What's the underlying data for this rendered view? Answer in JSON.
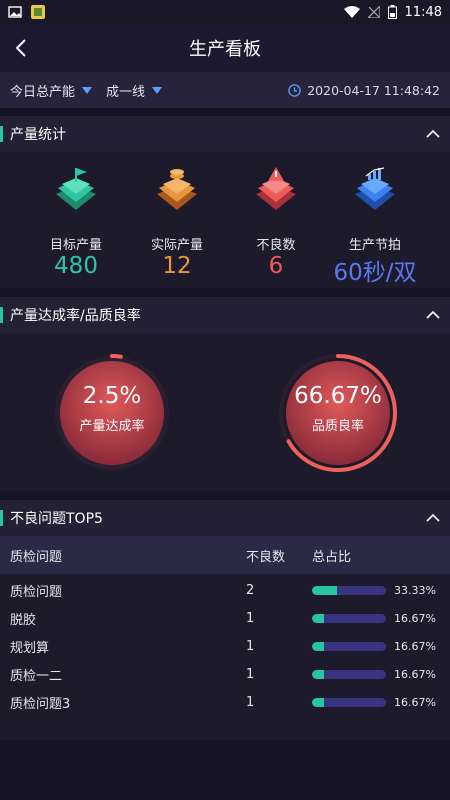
{
  "status": {
    "time": "11:48"
  },
  "nav": {
    "title": "生产看板"
  },
  "filters": {
    "capacity_label": "今日总产能",
    "line_label": "成一线",
    "datetime": "2020-04-17  11:48:42"
  },
  "production": {
    "title": "产量统计",
    "stats": [
      {
        "label": "目标产量",
        "value": "480",
        "color": "#2ec6a2",
        "icon": "flag-pyramid-icon"
      },
      {
        "label": "实际产量",
        "value": "12",
        "color": "#e8973b",
        "icon": "coins-pyramid-icon"
      },
      {
        "label": "不良数",
        "value": "6",
        "color": "#f05a5a",
        "icon": "warning-pyramid-icon"
      },
      {
        "label": "生产节拍",
        "value": "60秒/双",
        "color": "#5b78f0",
        "icon": "trend-pyramid-icon"
      }
    ]
  },
  "rates": {
    "title": "产量达成率/品质良率",
    "items": [
      {
        "pct": "2.5%",
        "label": "产量达成率",
        "value": 2.5
      },
      {
        "pct": "66.67%",
        "label": "品质良率",
        "value": 66.67
      }
    ]
  },
  "top5": {
    "title": "不良问题TOP5",
    "headers": {
      "issue": "质检问题",
      "count": "不良数",
      "ratio": "总占比"
    },
    "rows": [
      {
        "issue": "质检问题",
        "count": "2",
        "pct": "33.33%",
        "ratio": 33.33
      },
      {
        "issue": "脱胶",
        "count": "1",
        "pct": "16.67%",
        "ratio": 16.67
      },
      {
        "issue": "规划算",
        "count": "1",
        "pct": "16.67%",
        "ratio": 16.67
      },
      {
        "issue": "质检一二",
        "count": "1",
        "pct": "16.67%",
        "ratio": 16.67
      },
      {
        "issue": "质检问题3",
        "count": "1",
        "pct": "16.67%",
        "ratio": 16.67
      }
    ]
  }
}
